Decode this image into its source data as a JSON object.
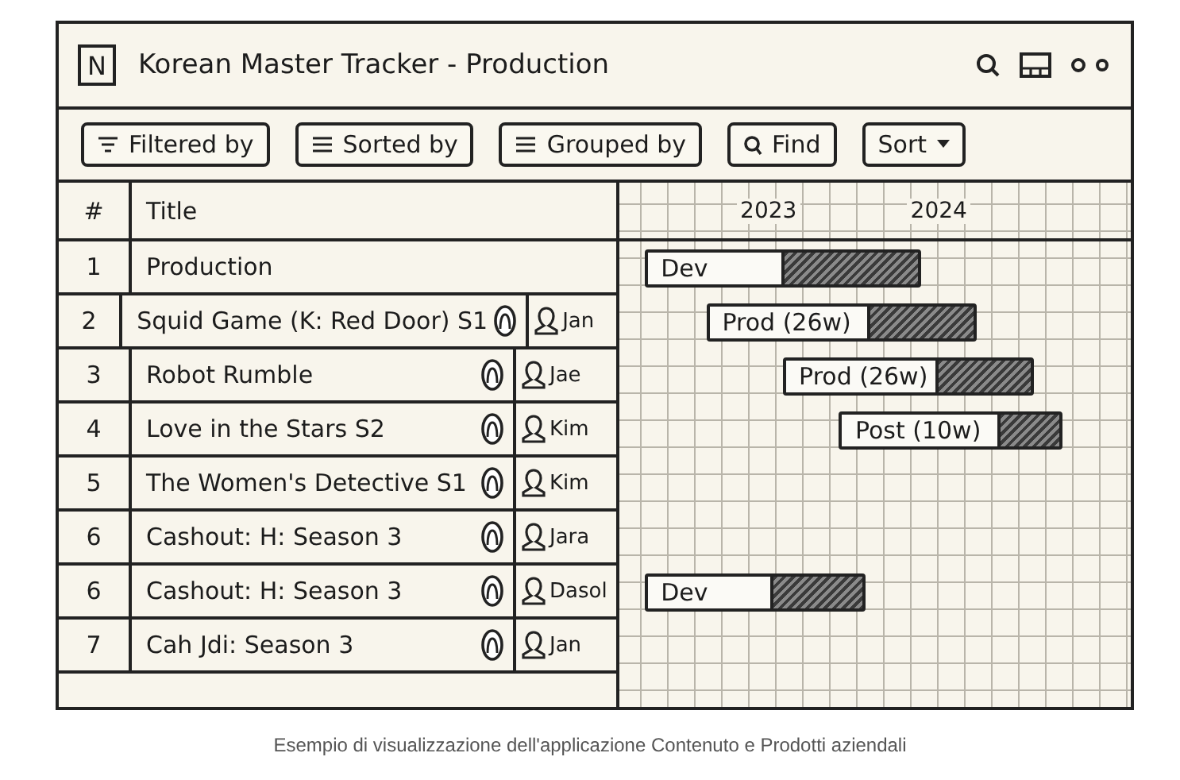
{
  "window": {
    "logo": "N",
    "title": "Korean Master Tracker - Production"
  },
  "toolbar": [
    {
      "label": "Filtered by",
      "kind": "filter"
    },
    {
      "label": "Sorted by",
      "kind": "lines"
    },
    {
      "label": "Grouped by",
      "kind": "lines"
    },
    {
      "label": "Find",
      "kind": "search"
    },
    {
      "label": "Sort",
      "kind": "dropdown"
    }
  ],
  "table": {
    "columns": [
      "#",
      "Title"
    ],
    "rows": [
      {
        "number": "1",
        "title": "Production",
        "bar": "Dev"
      },
      {
        "number": "2",
        "title": "Squid Game (K: Red Door) S1",
        "assignee": "Jan",
        "bar": "Prod (26w)"
      },
      {
        "number": "3",
        "title": "Robot Rumble",
        "assignee": "Jae",
        "bar": "Prod (26w)"
      },
      {
        "number": "4",
        "title": "Love in the Stars S2",
        "assignee": "Kim",
        "bar": "Post (10w)"
      },
      {
        "number": "5",
        "title": "The Women's Detective S1",
        "assignee": "Kim"
      },
      {
        "number": "6",
        "title": "Cashout: H: Season 3",
        "assignee": "Jara"
      },
      {
        "number": "6",
        "title": "Cashout: H: Season 3",
        "assignee": "Dasol",
        "bar": "Dev"
      },
      {
        "number": "7",
        "title": "Cah Jdi: Season 3",
        "assignee": "Jan"
      }
    ]
  },
  "timeline": {
    "years": [
      "2023",
      "2024"
    ]
  },
  "caption": "Esempio di visualizzazione dell'applicazione Contenuto e Prodotti aziendali"
}
